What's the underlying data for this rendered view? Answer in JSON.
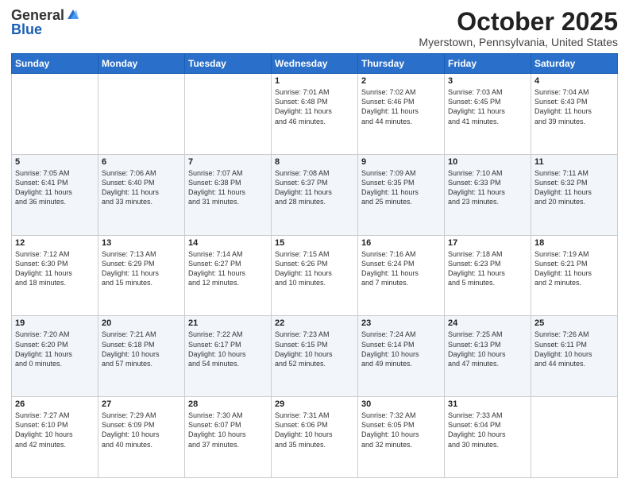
{
  "header": {
    "logo_general": "General",
    "logo_blue": "Blue",
    "month": "October 2025",
    "location": "Myerstown, Pennsylvania, United States"
  },
  "days_of_week": [
    "Sunday",
    "Monday",
    "Tuesday",
    "Wednesday",
    "Thursday",
    "Friday",
    "Saturday"
  ],
  "weeks": [
    [
      {
        "day": "",
        "info": ""
      },
      {
        "day": "",
        "info": ""
      },
      {
        "day": "",
        "info": ""
      },
      {
        "day": "1",
        "info": "Sunrise: 7:01 AM\nSunset: 6:48 PM\nDaylight: 11 hours\nand 46 minutes."
      },
      {
        "day": "2",
        "info": "Sunrise: 7:02 AM\nSunset: 6:46 PM\nDaylight: 11 hours\nand 44 minutes."
      },
      {
        "day": "3",
        "info": "Sunrise: 7:03 AM\nSunset: 6:45 PM\nDaylight: 11 hours\nand 41 minutes."
      },
      {
        "day": "4",
        "info": "Sunrise: 7:04 AM\nSunset: 6:43 PM\nDaylight: 11 hours\nand 39 minutes."
      }
    ],
    [
      {
        "day": "5",
        "info": "Sunrise: 7:05 AM\nSunset: 6:41 PM\nDaylight: 11 hours\nand 36 minutes."
      },
      {
        "day": "6",
        "info": "Sunrise: 7:06 AM\nSunset: 6:40 PM\nDaylight: 11 hours\nand 33 minutes."
      },
      {
        "day": "7",
        "info": "Sunrise: 7:07 AM\nSunset: 6:38 PM\nDaylight: 11 hours\nand 31 minutes."
      },
      {
        "day": "8",
        "info": "Sunrise: 7:08 AM\nSunset: 6:37 PM\nDaylight: 11 hours\nand 28 minutes."
      },
      {
        "day": "9",
        "info": "Sunrise: 7:09 AM\nSunset: 6:35 PM\nDaylight: 11 hours\nand 25 minutes."
      },
      {
        "day": "10",
        "info": "Sunrise: 7:10 AM\nSunset: 6:33 PM\nDaylight: 11 hours\nand 23 minutes."
      },
      {
        "day": "11",
        "info": "Sunrise: 7:11 AM\nSunset: 6:32 PM\nDaylight: 11 hours\nand 20 minutes."
      }
    ],
    [
      {
        "day": "12",
        "info": "Sunrise: 7:12 AM\nSunset: 6:30 PM\nDaylight: 11 hours\nand 18 minutes."
      },
      {
        "day": "13",
        "info": "Sunrise: 7:13 AM\nSunset: 6:29 PM\nDaylight: 11 hours\nand 15 minutes."
      },
      {
        "day": "14",
        "info": "Sunrise: 7:14 AM\nSunset: 6:27 PM\nDaylight: 11 hours\nand 12 minutes."
      },
      {
        "day": "15",
        "info": "Sunrise: 7:15 AM\nSunset: 6:26 PM\nDaylight: 11 hours\nand 10 minutes."
      },
      {
        "day": "16",
        "info": "Sunrise: 7:16 AM\nSunset: 6:24 PM\nDaylight: 11 hours\nand 7 minutes."
      },
      {
        "day": "17",
        "info": "Sunrise: 7:18 AM\nSunset: 6:23 PM\nDaylight: 11 hours\nand 5 minutes."
      },
      {
        "day": "18",
        "info": "Sunrise: 7:19 AM\nSunset: 6:21 PM\nDaylight: 11 hours\nand 2 minutes."
      }
    ],
    [
      {
        "day": "19",
        "info": "Sunrise: 7:20 AM\nSunset: 6:20 PM\nDaylight: 11 hours\nand 0 minutes."
      },
      {
        "day": "20",
        "info": "Sunrise: 7:21 AM\nSunset: 6:18 PM\nDaylight: 10 hours\nand 57 minutes."
      },
      {
        "day": "21",
        "info": "Sunrise: 7:22 AM\nSunset: 6:17 PM\nDaylight: 10 hours\nand 54 minutes."
      },
      {
        "day": "22",
        "info": "Sunrise: 7:23 AM\nSunset: 6:15 PM\nDaylight: 10 hours\nand 52 minutes."
      },
      {
        "day": "23",
        "info": "Sunrise: 7:24 AM\nSunset: 6:14 PM\nDaylight: 10 hours\nand 49 minutes."
      },
      {
        "day": "24",
        "info": "Sunrise: 7:25 AM\nSunset: 6:13 PM\nDaylight: 10 hours\nand 47 minutes."
      },
      {
        "day": "25",
        "info": "Sunrise: 7:26 AM\nSunset: 6:11 PM\nDaylight: 10 hours\nand 44 minutes."
      }
    ],
    [
      {
        "day": "26",
        "info": "Sunrise: 7:27 AM\nSunset: 6:10 PM\nDaylight: 10 hours\nand 42 minutes."
      },
      {
        "day": "27",
        "info": "Sunrise: 7:29 AM\nSunset: 6:09 PM\nDaylight: 10 hours\nand 40 minutes."
      },
      {
        "day": "28",
        "info": "Sunrise: 7:30 AM\nSunset: 6:07 PM\nDaylight: 10 hours\nand 37 minutes."
      },
      {
        "day": "29",
        "info": "Sunrise: 7:31 AM\nSunset: 6:06 PM\nDaylight: 10 hours\nand 35 minutes."
      },
      {
        "day": "30",
        "info": "Sunrise: 7:32 AM\nSunset: 6:05 PM\nDaylight: 10 hours\nand 32 minutes."
      },
      {
        "day": "31",
        "info": "Sunrise: 7:33 AM\nSunset: 6:04 PM\nDaylight: 10 hours\nand 30 minutes."
      },
      {
        "day": "",
        "info": ""
      }
    ]
  ]
}
